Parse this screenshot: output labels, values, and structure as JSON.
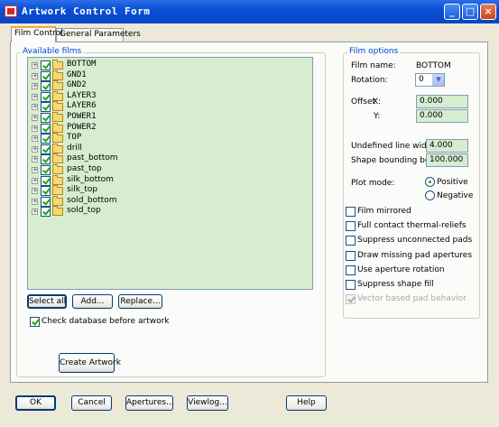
{
  "window": {
    "title": "Artwork Control Form"
  },
  "tabs": [
    {
      "label": "Film Control",
      "active": true
    },
    {
      "label": "General Parameters",
      "active": false
    }
  ],
  "films": {
    "group_label": "Available films",
    "items": [
      {
        "name": "BOTTOM",
        "checked": true
      },
      {
        "name": "GND1",
        "checked": true
      },
      {
        "name": "GND2",
        "checked": true
      },
      {
        "name": "LAYER3",
        "checked": true
      },
      {
        "name": "LAYER6",
        "checked": true
      },
      {
        "name": "POWER1",
        "checked": true
      },
      {
        "name": "POWER2",
        "checked": true
      },
      {
        "name": "TOP",
        "checked": true
      },
      {
        "name": "drill",
        "checked": true
      },
      {
        "name": "past_bottom",
        "checked": true
      },
      {
        "name": "past_top",
        "checked": true
      },
      {
        "name": "silk_bottom",
        "checked": true
      },
      {
        "name": "silk_top",
        "checked": true
      },
      {
        "name": "sold_bottom",
        "checked": true
      },
      {
        "name": "sold_top",
        "checked": true
      }
    ],
    "select_all": "Select all",
    "add": "Add...",
    "replace": "Replace...",
    "check_db": {
      "label": "Check database before artwork",
      "checked": true
    },
    "create": "Create Artwork"
  },
  "options": {
    "group_label": "Film options",
    "film_name_label": "Film name:",
    "film_name": "BOTTOM",
    "rotation_label": "Rotation:",
    "rotation": "0",
    "offset_label": "Offset",
    "x_label": "X:",
    "x_value": "0.000",
    "y_label": "Y:",
    "y_value": "0.000",
    "undef_label": "Undefined line width:",
    "undef_value": "4.000",
    "shape_label": "Shape bounding box:",
    "shape_value": "100.000",
    "plot_label": "Plot mode:",
    "positive": "Positive",
    "negative": "Negative",
    "plot_mode": "Positive",
    "checks": [
      {
        "label": "Film mirrored",
        "checked": false,
        "enabled": true
      },
      {
        "label": "Full contact thermal-reliefs",
        "checked": false,
        "enabled": true
      },
      {
        "label": "Suppress unconnected pads",
        "checked": false,
        "enabled": true
      },
      {
        "label": "Draw missing pad apertures",
        "checked": false,
        "enabled": true
      },
      {
        "label": "Use aperture rotation",
        "checked": false,
        "enabled": true
      },
      {
        "label": "Suppress shape fill",
        "checked": false,
        "enabled": true
      },
      {
        "label": "Vector based pad behavior",
        "checked": true,
        "enabled": false
      }
    ]
  },
  "footer": {
    "ok": "OK",
    "cancel": "Cancel",
    "apertures": "Apertures...",
    "viewlog": "Viewlog...",
    "help": "Help"
  }
}
